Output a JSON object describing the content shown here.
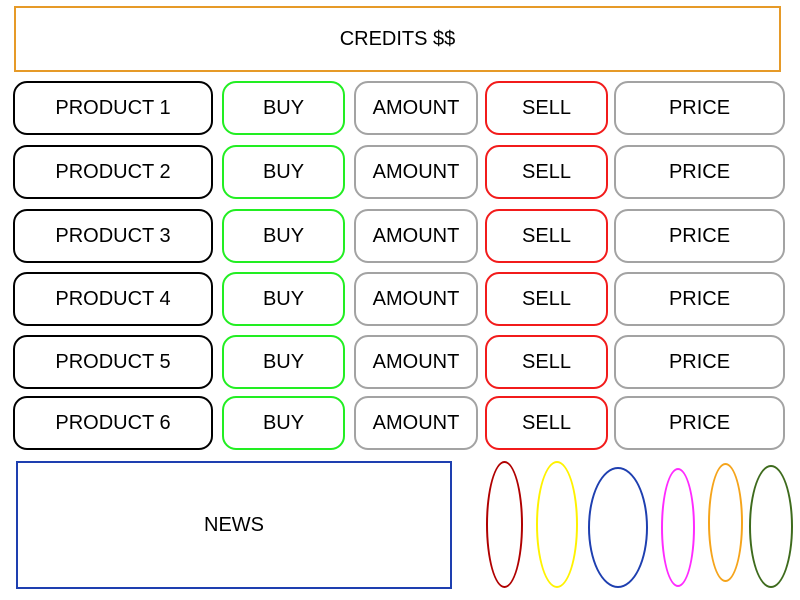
{
  "header": {
    "credits_label": "CREDITS $$"
  },
  "market": {
    "rows": [
      {
        "product": "PRODUCT 1",
        "buy": "BUY",
        "amount": "AMOUNT",
        "sell": "SELL",
        "price": "PRICE"
      },
      {
        "product": "PRODUCT 2",
        "buy": "BUY",
        "amount": "AMOUNT",
        "sell": "SELL",
        "price": "PRICE"
      },
      {
        "product": "PRODUCT 3",
        "buy": "BUY",
        "amount": "AMOUNT",
        "sell": "SELL",
        "price": "PRICE"
      },
      {
        "product": "PRODUCT 4",
        "buy": "BUY",
        "amount": "AMOUNT",
        "sell": "SELL",
        "price": "PRICE"
      },
      {
        "product": "PRODUCT 5",
        "buy": "BUY",
        "amount": "AMOUNT",
        "sell": "SELL",
        "price": "PRICE"
      },
      {
        "product": "PRODUCT 6",
        "buy": "BUY",
        "amount": "AMOUNT",
        "sell": "SELL",
        "price": "PRICE"
      }
    ]
  },
  "news": {
    "label": "NEWS"
  },
  "ovals": [
    {
      "color": "#B00000"
    },
    {
      "color": "#FFF200"
    },
    {
      "color": "#1E3FB0"
    },
    {
      "color": "#FF2BFF"
    },
    {
      "color": "#F5A41B"
    },
    {
      "color": "#3E6B1D"
    }
  ],
  "colors": {
    "credits_border": "#E69A28",
    "product_border": "#000000",
    "buy_border": "#22EE22",
    "amount_border": "#A3A3A3",
    "sell_border": "#F21B1B",
    "price_border": "#A3A3A3",
    "news_border": "#1E3FB0"
  }
}
